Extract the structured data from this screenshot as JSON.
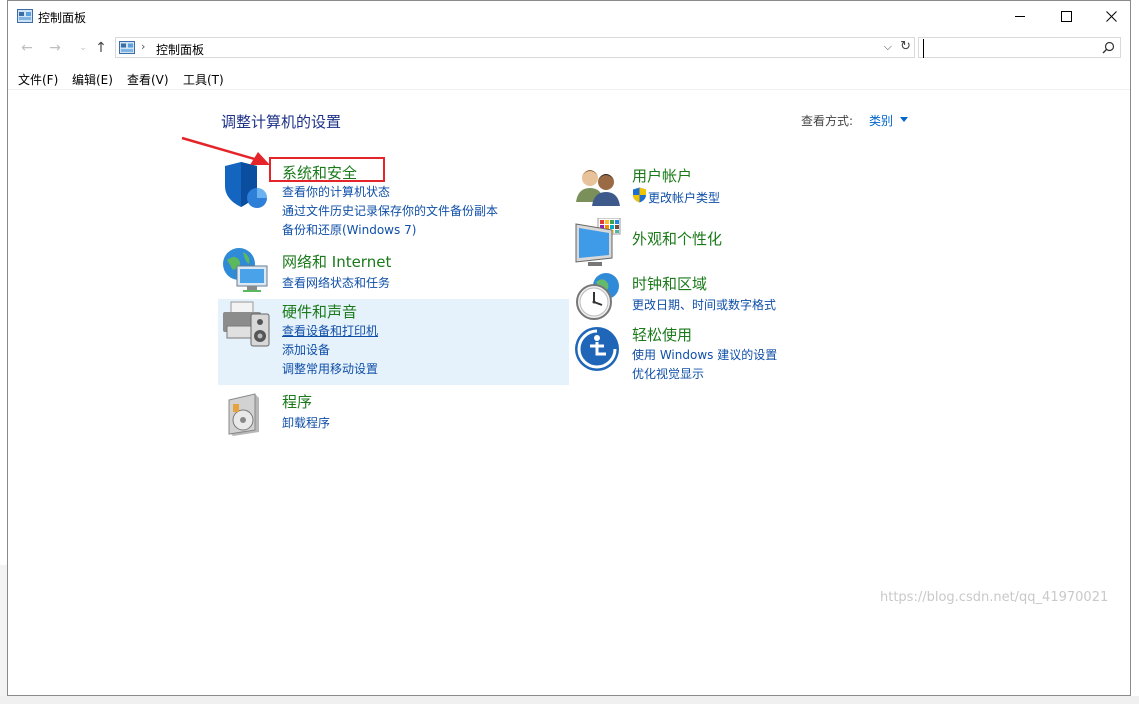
{
  "window": {
    "title": "控制面板",
    "minimize_glyph": "—",
    "maximize_glyph": "☐",
    "close_glyph": "✕"
  },
  "navbar": {
    "back_glyph": "←",
    "forward_glyph": "→",
    "recent_glyph": "⌄",
    "up_glyph": "↑",
    "breadcrumb_sep": "›",
    "breadcrumb": "控制面板",
    "dropdown_glyph": "⌵",
    "refresh_glyph": "↻",
    "search_value": "",
    "search_icon": "search-icon"
  },
  "menu": {
    "items": [
      "文件(F)",
      "编辑(E)",
      "查看(V)",
      "工具(T)"
    ]
  },
  "main": {
    "heading": "调整计算机的设置",
    "view_by_label": "查看方式:",
    "view_by_value": "类别",
    "categories": [
      {
        "title": "系统和安全",
        "icon": "shield-icon",
        "links": [
          "查看你的计算机状态",
          "通过文件历史记录保存你的文件备份副本",
          "备份和还原(Windows 7)"
        ]
      },
      {
        "title": "网络和 Internet",
        "icon": "network-globe-icon",
        "links": [
          "查看网络状态和任务"
        ]
      },
      {
        "title": "硬件和声音",
        "icon": "printer-speaker-icon",
        "links": [
          "查看设备和打印机",
          "添加设备",
          "调整常用移动设置"
        ]
      },
      {
        "title": "程序",
        "icon": "programs-disc-icon",
        "links": [
          "卸载程序"
        ]
      },
      {
        "title": "用户帐户",
        "icon": "users-icon",
        "links": [
          "更改帐户类型"
        ]
      },
      {
        "title": "外观和个性化",
        "icon": "monitor-palette-icon",
        "links": []
      },
      {
        "title": "时钟和区域",
        "icon": "clock-globe-icon",
        "links": [
          "更改日期、时间或数字格式"
        ]
      },
      {
        "title": "轻松使用",
        "icon": "ease-of-access-icon",
        "links": [
          "使用 Windows 建议的设置",
          "优化视觉显示"
        ]
      }
    ]
  },
  "annotation": {
    "highlight_color": "#e5242a"
  },
  "watermark": "https://blog.csdn.net/qq_41970021"
}
